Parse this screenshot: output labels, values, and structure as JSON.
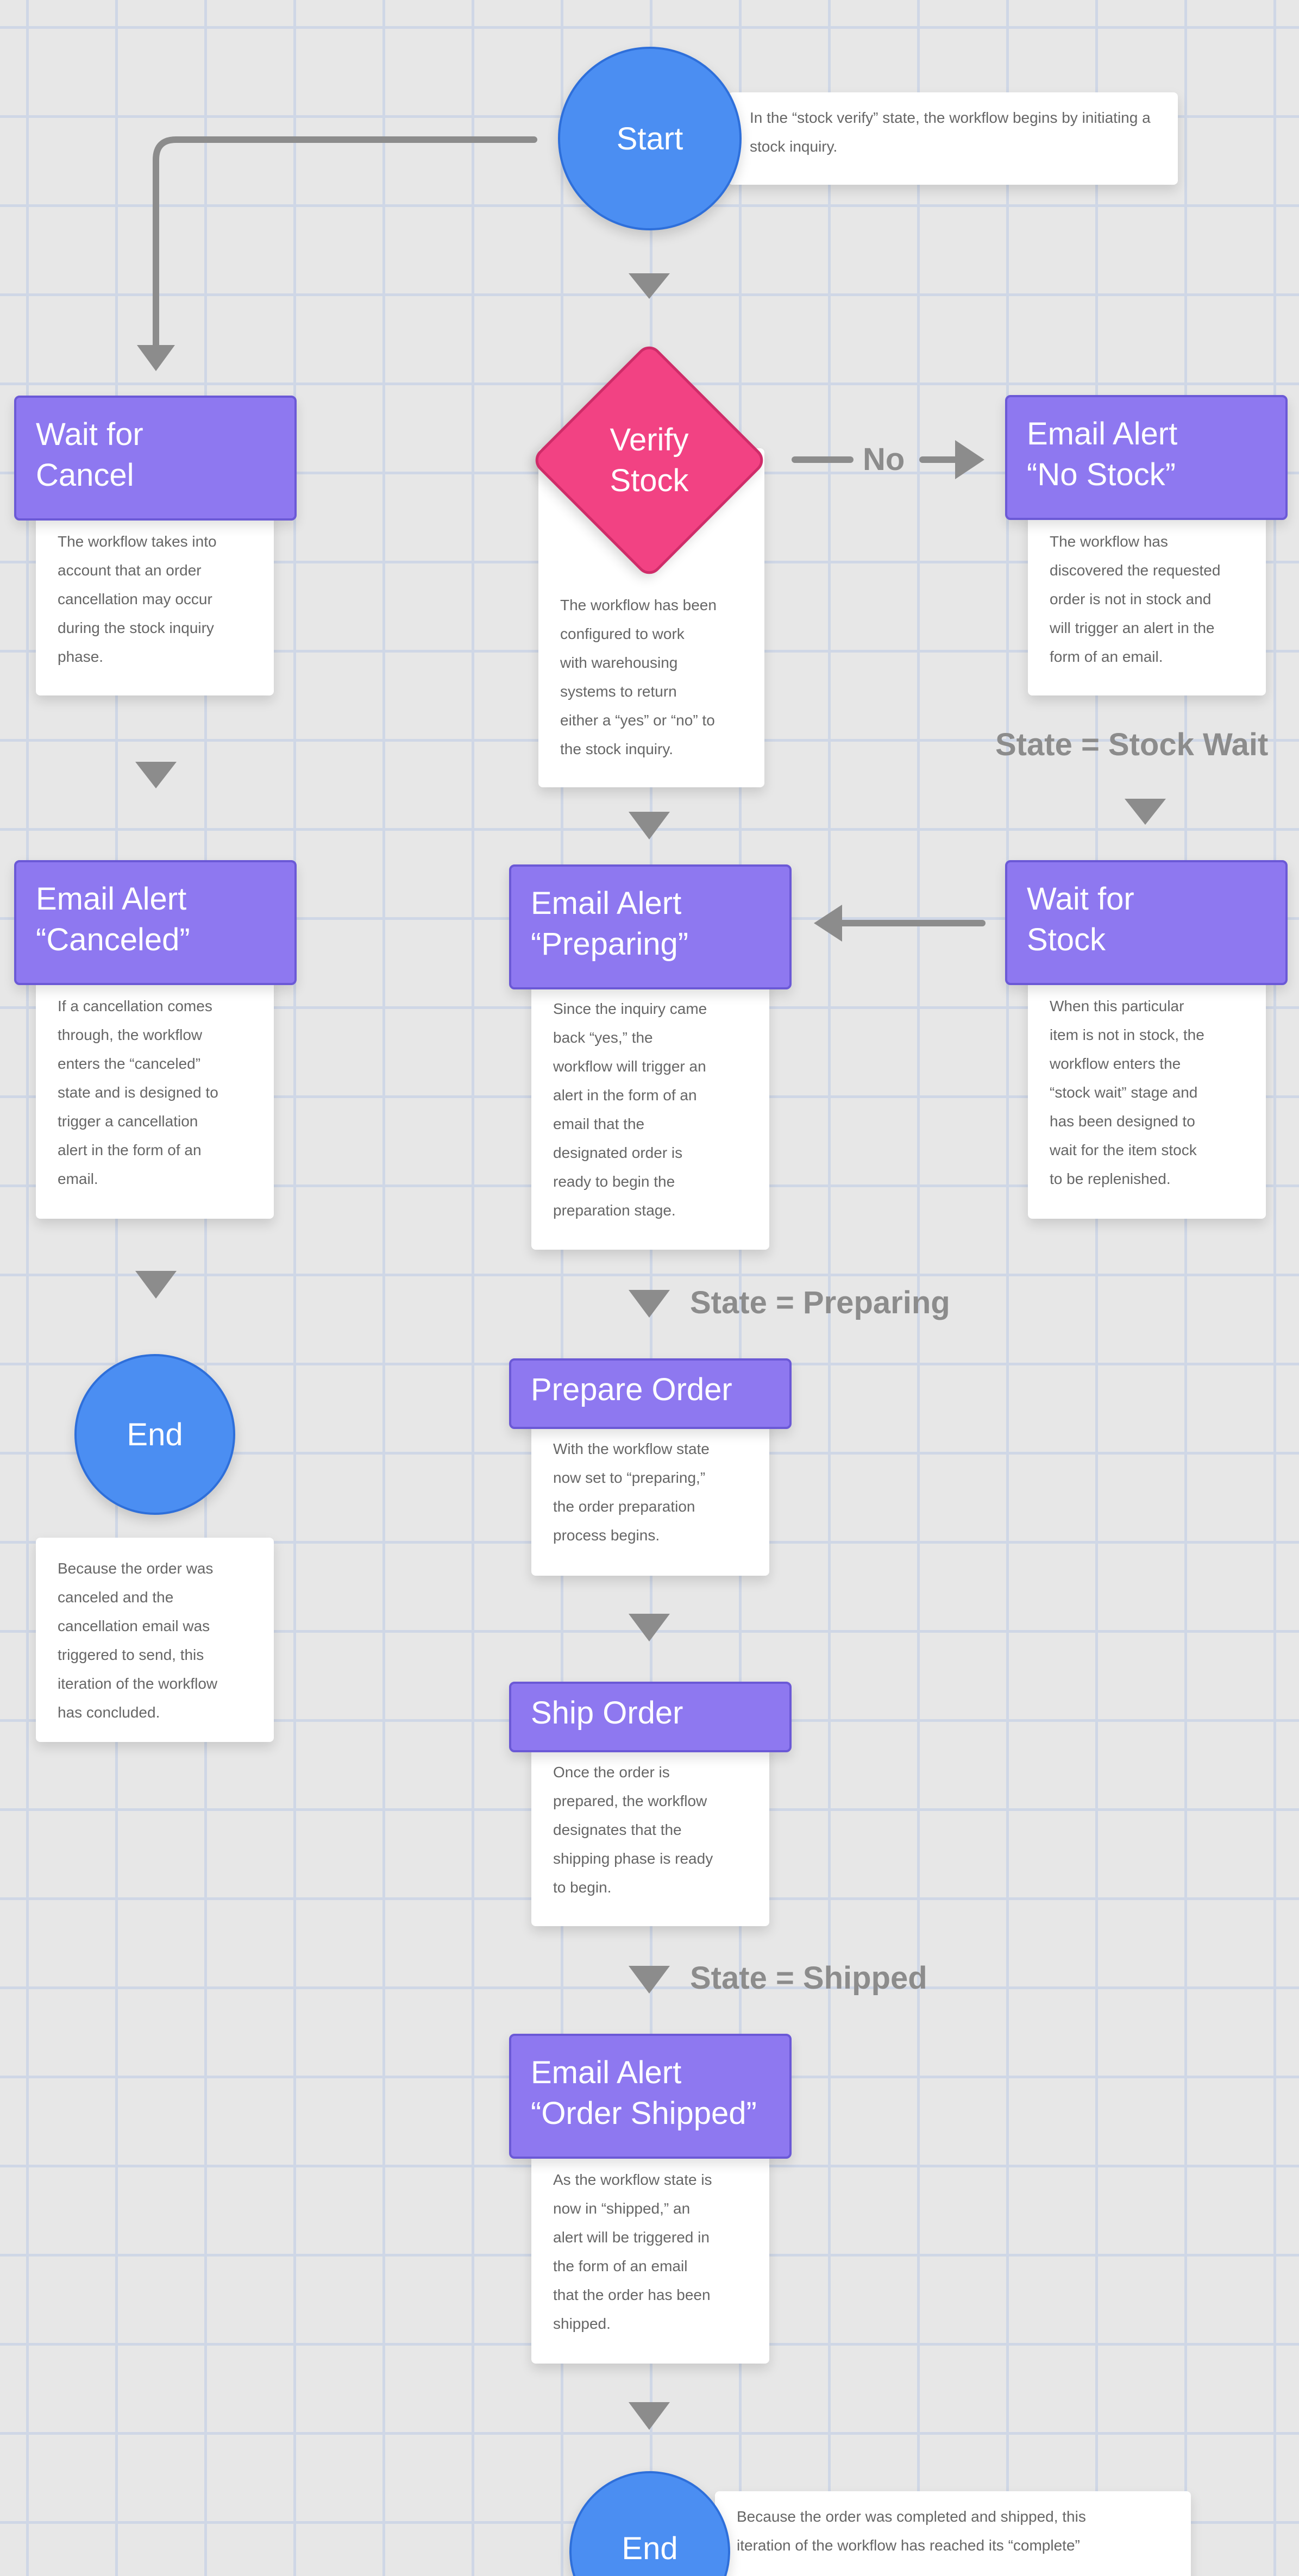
{
  "nodes": {
    "start": {
      "label": "Start",
      "note": "In the “stock verify” state, the workflow begins by initiating a stock inquiry."
    },
    "wait_cancel": {
      "title": "Wait for\nCancel",
      "body": "The workflow takes into\naccount that an order\ncancellation may occur\nduring the stock inquiry\nphase."
    },
    "verify_stock": {
      "title": "Verify\nStock",
      "body": "The workflow has been\nconfigured to work\nwith warehousing\nsystems to return\neither a “yes” or “no” to\nthe stock inquiry."
    },
    "email_no_stock": {
      "title": "Email Alert\n“No Stock”",
      "body": "The workflow has\ndiscovered the requested\norder is not in stock and\nwill trigger an alert in the\nform of an email."
    },
    "email_canceled": {
      "title": "Email Alert\n“Canceled”",
      "body": "If a cancellation comes\nthrough, the workflow\nenters the “canceled”\nstate and is designed to\ntrigger a cancellation\nalert in the form of an\nemail."
    },
    "email_preparing": {
      "title": "Email Alert\n“Preparing”",
      "body": "Since the inquiry came\nback “yes,” the\nworkflow will trigger an\nalert in the form of an\nemail that the\ndesignated order is\nready to begin the\npreparation stage."
    },
    "wait_stock": {
      "title": "Wait for\nStock",
      "body": "When this particular\nitem is not in stock, the\nworkflow enters the\n“stock wait” stage and\nhas been designed to\nwait for the item stock\nto be replenished."
    },
    "end_canceled": {
      "label": "End",
      "body": "Because the order was\ncanceled and the\ncancellation email was\ntriggered to send, this\niteration of the workflow\nhas concluded."
    },
    "prepare_order": {
      "title": "Prepare Order",
      "body": "With the workflow state\nnow set to “preparing,”\nthe order preparation\nprocess begins."
    },
    "ship_order": {
      "title": "Ship Order",
      "body": "Once the order is\nprepared, the workflow\ndesignates that the\nshipping phase is ready\nto begin."
    },
    "email_shipped": {
      "title": "Email Alert\n“Order Shipped”",
      "body": "As the workflow state is\nnow in “shipped,” an\nalert will be triggered in\nthe form of an email\nthat the order has been\nshipped."
    },
    "end_shipped": {
      "label": "End",
      "note": "Because the order was completed and shipped, this\niteration of the workflow has reached its “complete”"
    }
  },
  "edge_labels": {
    "no": "No",
    "state_stock_wait": "State = Stock Wait",
    "state_preparing": "State = Preparing",
    "state_shipped": "State = Shipped"
  },
  "colors": {
    "background": "#e7e7e7",
    "grid": "#cfd7e6",
    "process": "#8e78f0",
    "decision": "#f24283",
    "terminal": "#4b8ef2",
    "connector": "#8c8c8c"
  }
}
